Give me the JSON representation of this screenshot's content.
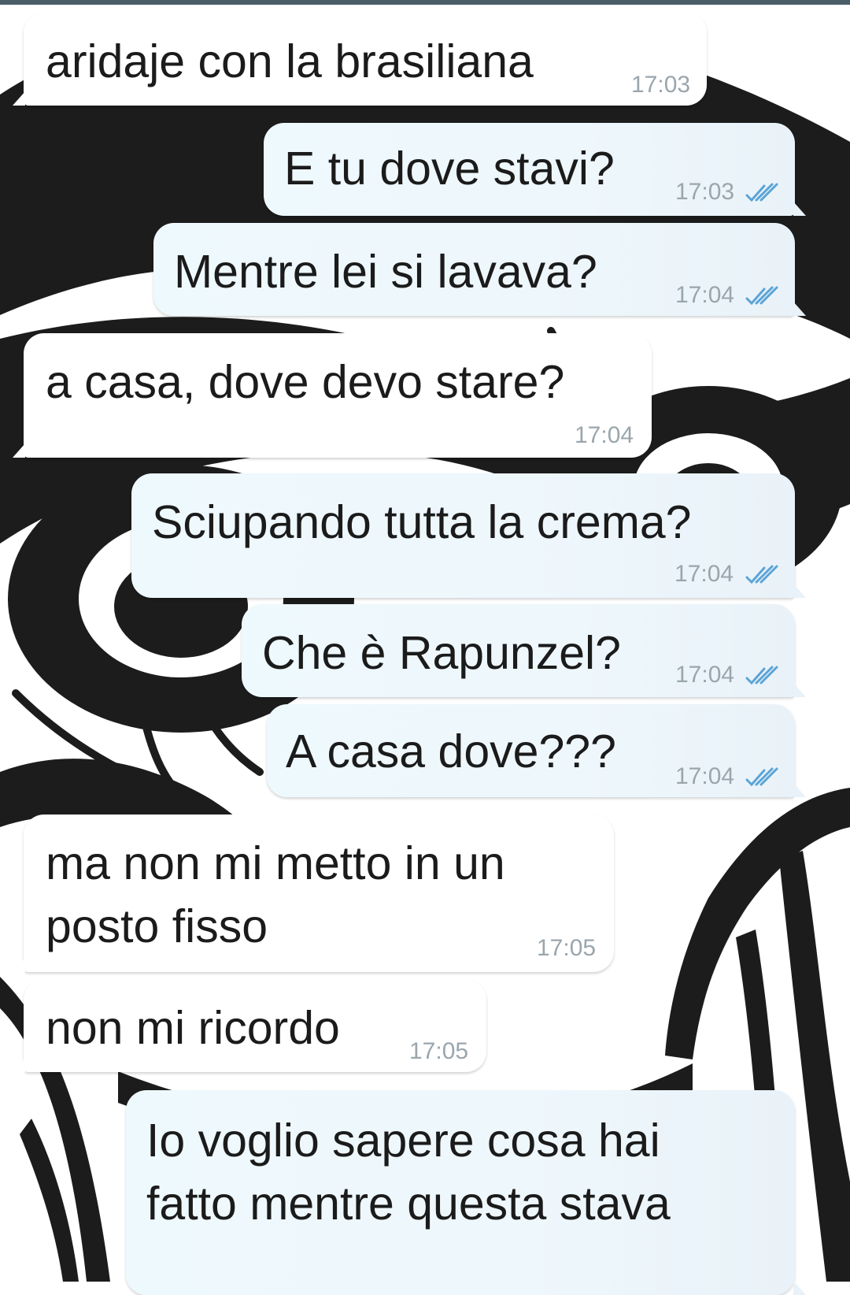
{
  "colors": {
    "incoming_bubble": "#ffffff",
    "outgoing_bubble": "#eef7fc",
    "time_text": "#9aa6ad",
    "read_ticks": "#5ba4d6",
    "wallpaper_ink": "#1c1c1c"
  },
  "messages": [
    {
      "direction": "in",
      "text": "aridaje con la brasiliana",
      "time": "17:03"
    },
    {
      "direction": "out",
      "text": "E tu dove stavi?",
      "time": "17:03",
      "status": "read-double-check-icon"
    },
    {
      "direction": "out",
      "text": "Mentre lei si lavava?",
      "time": "17:04",
      "status": "read-double-check-icon"
    },
    {
      "direction": "in",
      "text": "a casa, dove devo stare?",
      "time": "17:04"
    },
    {
      "direction": "out",
      "text": "Sciupando tutta la crema?",
      "time": "17:04",
      "status": "read-double-check-icon"
    },
    {
      "direction": "out",
      "text": "Che è Rapunzel?",
      "time": "17:04",
      "status": "read-double-check-icon"
    },
    {
      "direction": "out",
      "text": "A casa dove???",
      "time": "17:04",
      "status": "read-double-check-icon"
    },
    {
      "direction": "in",
      "text_lines": [
        "ma non mi metto in un",
        "posto fisso"
      ],
      "time": "17:05"
    },
    {
      "direction": "in",
      "text": "non mi ricordo",
      "time": "17:05"
    },
    {
      "direction": "out",
      "text_lines": [
        "Io voglio sapere cosa hai",
        "fatto mentre questa stava"
      ]
    }
  ]
}
